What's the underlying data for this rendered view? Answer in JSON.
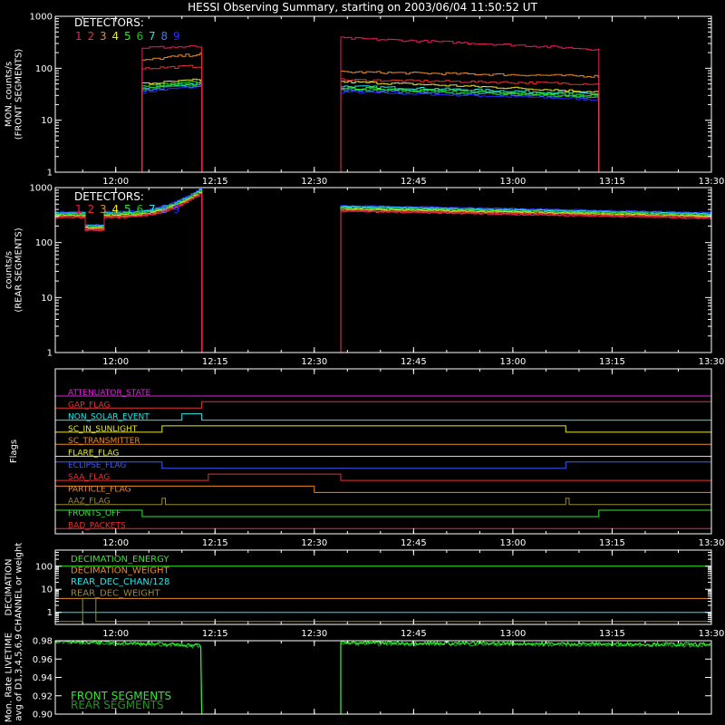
{
  "chart_data": {
    "type": "line",
    "title": "HESSI Observing Summary, starting on 2003/06/04 11:50:52 UT",
    "time_ticks": [
      "12:00",
      "12:15",
      "12:30",
      "12:45",
      "13:00",
      "13:15",
      "13:30"
    ],
    "time_range": [
      "11:50:52",
      "13:30:00"
    ],
    "detector_colors": [
      "#e8205a",
      "#e83030",
      "#e88a28",
      "#e8e830",
      "#30e830",
      "#20c020",
      "#20e8e8",
      "#3a7bff",
      "#2a2aff"
    ],
    "panels": [
      {
        "id": "front",
        "ylabel": "MON. counts/s\n(FRONT SEGMENTS)",
        "ylim": [
          1,
          1000
        ],
        "log_y": true,
        "y_ticks": [
          "1",
          "10",
          "100",
          "1000"
        ],
        "legend_title": "DETECTORS:",
        "legend_entries": [
          "1",
          "2",
          "3",
          "4",
          "5",
          "6",
          "7",
          "8",
          "9"
        ],
        "segments": [
          [
            "12:04",
            "12:13"
          ],
          [
            "12:34",
            "13:13"
          ]
        ],
        "series": [
          {
            "detector": 1,
            "levels_seg1": [
              250,
              260
            ],
            "levels_seg2": [
              380,
              230
            ]
          },
          {
            "detector": 2,
            "levels_seg1": [
              100,
              110
            ],
            "levels_seg2": [
              60,
              50
            ]
          },
          {
            "detector": 3,
            "levels_seg1": [
              140,
              190
            ],
            "levels_seg2": [
              85,
              70
            ]
          },
          {
            "detector": 4,
            "levels_seg1": [
              50,
              60
            ],
            "levels_seg2": [
              55,
              35
            ]
          },
          {
            "detector": 5,
            "levels_seg1": [
              45,
              55
            ],
            "levels_seg2": [
              42,
              30
            ]
          },
          {
            "detector": 6,
            "levels_seg1": [
              40,
              50
            ],
            "levels_seg2": [
              40,
              28
            ]
          },
          {
            "detector": 7,
            "levels_seg1": [
              42,
              52
            ],
            "levels_seg2": [
              45,
              32
            ]
          },
          {
            "detector": 8,
            "levels_seg1": [
              38,
              48
            ],
            "levels_seg2": [
              38,
              27
            ]
          },
          {
            "detector": 9,
            "levels_seg1": [
              35,
              45
            ],
            "levels_seg2": [
              35,
              25
            ]
          }
        ]
      },
      {
        "id": "rear",
        "ylabel": "counts/s\n(REAR SEGMENTS)",
        "ylim": [
          1,
          1000
        ],
        "log_y": true,
        "y_ticks": [
          "1",
          "10",
          "100",
          "1000"
        ],
        "legend_title": "DETECTORS:",
        "legend_entries": [
          "1",
          "2",
          "3",
          "4",
          "5",
          "6",
          "7",
          "8",
          "9"
        ],
        "segments": [
          [
            "11:50:52",
            "12:13"
          ],
          [
            "12:34",
            "13:30"
          ]
        ],
        "levels_seg1": [
          320,
          900
        ],
        "dip": [
          "11:55",
          "11:58",
          190
        ],
        "levels_seg2": [
          420,
          310
        ]
      },
      {
        "id": "flags",
        "ylabel": "Flags",
        "flags": [
          {
            "name": "ATTENUATOR_STATE",
            "color": "#e020e0",
            "transitions": []
          },
          {
            "name": "GAP_FLAG",
            "color": "#e83030",
            "transitions": [
              [
                "12:13",
                "13:32"
              ]
            ]
          },
          {
            "name": "NON_SOLAR_EVENT",
            "color": "#20e8e8",
            "transitions": [
              [
                "12:10",
                "12:13"
              ]
            ]
          },
          {
            "name": "SC_IN_SUNLIGHT",
            "color": "#e8e830",
            "transitions": [
              [
                "12:07",
                "13:08"
              ]
            ]
          },
          {
            "name": "SC_TRANSMITTER",
            "color": "#e88a28",
            "transitions": []
          },
          {
            "name": "FLARE_FLAG",
            "color": "#e8e830",
            "transitions": []
          },
          {
            "name": "ECLIPSE_FLAG",
            "color": "#3a5bff",
            "transitions": [
              [
                "11:50:52",
                "12:07"
              ],
              [
                "13:08",
                "13:30"
              ]
            ]
          },
          {
            "name": "SAA_FLAG",
            "color": "#e83030",
            "transitions": [
              [
                "12:14",
                "12:34"
              ]
            ]
          },
          {
            "name": "PARTICLE_FLAG",
            "color": "#e88a28",
            "transitions": [
              [
                "11:50:52",
                "12:30"
              ]
            ]
          },
          {
            "name": "AAZ_FLAG",
            "color": "#9a8a30",
            "transitions": [
              [
                "12:07",
                "12:07:30"
              ],
              [
                "13:08",
                "13:08:30"
              ]
            ]
          },
          {
            "name": "FRONTS_OFF",
            "color": "#30e830",
            "transitions": [
              [
                "11:50:52",
                "12:04"
              ],
              [
                "13:13",
                "13:30"
              ]
            ]
          },
          {
            "name": "BAD_PACKETS",
            "color": "#e83030",
            "transitions": []
          }
        ]
      },
      {
        "id": "decimation",
        "ylabel": "DECIMATION\nCHANNEL or weight",
        "ylim": [
          0.3,
          500
        ],
        "log_y": true,
        "y_ticks": [
          "1",
          "10",
          "100"
        ],
        "legend_entries": [
          {
            "name": "DECIMATION_ENERGY",
            "color": "#30e830"
          },
          {
            "name": "DECIMATION_WEIGHT",
            "color": "#e88a28"
          },
          {
            "name": "REAR_DEC_CHAN/128",
            "color": "#20e8e8"
          },
          {
            "name": "REAR_DEC_WEIGHT",
            "color": "#9a8a30"
          }
        ],
        "levels": {
          "DECIMATION_ENERGY": 100,
          "DECIMATION_WEIGHT": 4,
          "REAR_DEC_CHAN/128": 1,
          "REAR_DEC_WEIGHT": 0.4
        },
        "weight_pulse": [
          "11:55",
          "11:57",
          4
        ]
      },
      {
        "id": "livetime",
        "ylabel": "Mon. Rate LIVETIME\navg of D1,3,4,5,6,9",
        "ylim": [
          0.9,
          0.98
        ],
        "log_y": false,
        "y_ticks": [
          "0.90",
          "0.92",
          "0.94",
          "0.96",
          "0.98"
        ],
        "legend_entries": [
          {
            "name": "FRONT SEGMENTS",
            "color": "#30e830"
          },
          {
            "name": "REAR SEGMENTS",
            "color": "#1a9a1a"
          }
        ],
        "segments": [
          [
            "11:50:52",
            "12:13"
          ],
          [
            "12:34",
            "13:30"
          ]
        ],
        "levels_seg1": [
          0.98,
          0.975
        ],
        "levels_seg2": [
          0.978,
          0.976
        ]
      }
    ]
  }
}
